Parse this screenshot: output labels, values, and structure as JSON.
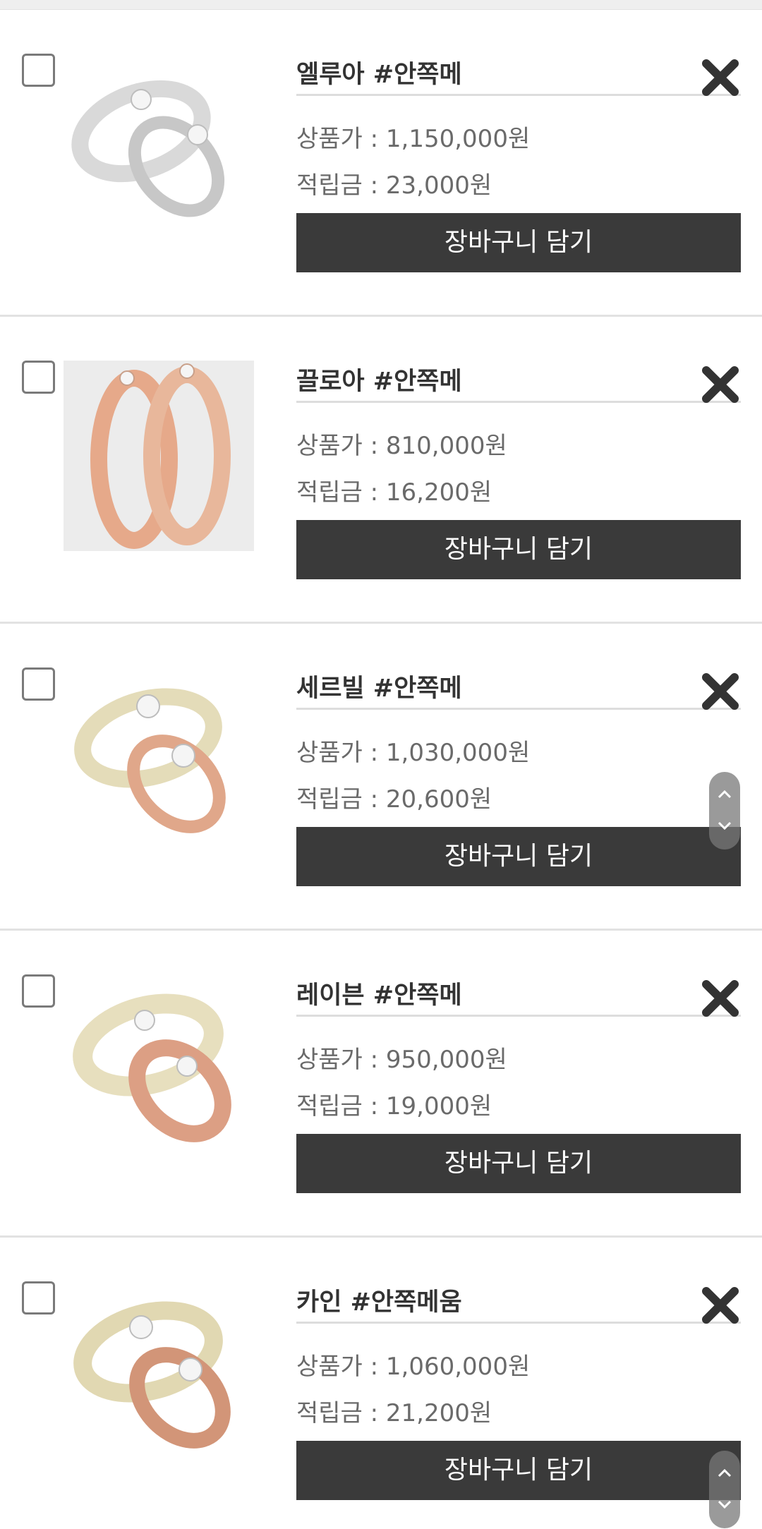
{
  "cart_items": [
    {
      "name": "엘루아 #안쪽메",
      "price": "상품가 : 1,150,000원",
      "points": "적립금 : 23,000원",
      "button": "장바구니 담기",
      "ring_color_a": "#d9d9d9",
      "ring_color_b": "#c7c7c7",
      "background": "#ffffff"
    },
    {
      "name": "끌로아 #안쪽메",
      "price": "상품가 : 810,000원",
      "points": "적립금 : 16,200원",
      "button": "장바구니 담기",
      "ring_color_a": "#e6a98a",
      "ring_color_b": "#e8b79b",
      "background": "#ececec"
    },
    {
      "name": "세르빌 #안쪽메",
      "price": "상품가 : 1,030,000원",
      "points": "적립금 : 20,600원",
      "button": "장바구니 담기",
      "ring_color_a": "#e4dcb9",
      "ring_color_b": "#e0a78a",
      "background": "#ffffff"
    },
    {
      "name": "레이븐 #안쪽메",
      "price": "상품가 : 950,000원",
      "points": "적립금 : 19,000원",
      "button": "장바구니 담기",
      "ring_color_a": "#e7dfbe",
      "ring_color_b": "#dc9f84",
      "background": "#ffffff"
    },
    {
      "name": "카인 #안쪽메움",
      "price": "상품가 : 1,060,000원",
      "points": "적립금 : 21,200원",
      "button": "장바구니 담기",
      "ring_color_a": "#e1d8b2",
      "ring_color_b": "#d29578",
      "background": "#ffffff"
    }
  ],
  "icons": {
    "remove": "close-x-icon",
    "scroll_up": "chevron-up-icon",
    "scroll_down": "chevron-down-icon"
  },
  "colors": {
    "button_bg": "#3a3a3a",
    "button_text": "#ffffff",
    "divider": "#e2e2e2",
    "text_dark": "#333333",
    "text_muted": "#6a6a6a"
  }
}
